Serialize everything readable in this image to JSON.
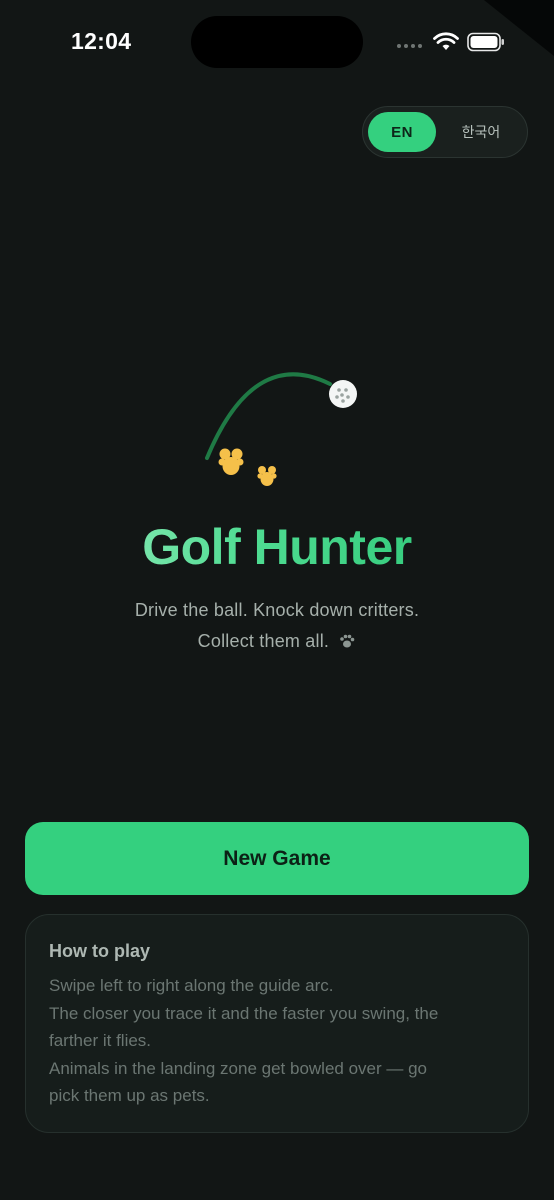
{
  "status_bar": {
    "time": "12:04"
  },
  "language_toggle": {
    "options": [
      "EN",
      "한국어"
    ],
    "selected": "EN"
  },
  "app": {
    "title": "Golf Hunter",
    "tagline_line1": "Drive the ball. Knock down critters.",
    "tagline_line2": "Collect them all.",
    "tagline_icon": "paw-icon"
  },
  "actions": {
    "new_game_label": "New Game"
  },
  "how_to_play": {
    "heading": "How to play",
    "lines": [
      "Swipe left to right along the guide arc.",
      "The closer you trace it and the faster you swing, the",
      "farther it flies.",
      "Animals in the landing zone get bowled over — go",
      "pick them up as pets."
    ]
  },
  "colors": {
    "background": "#121615",
    "accent": "#34d07f",
    "arc": "#1f7a45",
    "critter": "#f5c04a"
  },
  "icons": [
    "wifi-icon",
    "battery-icon",
    "golf-ball-icon",
    "critter-icon",
    "paw-icon"
  ]
}
